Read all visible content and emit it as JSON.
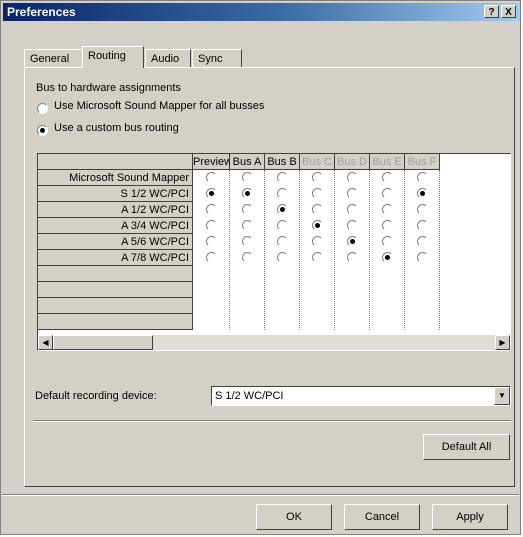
{
  "window": {
    "title": "Preferences",
    "help_btn": "?",
    "close_btn": "X"
  },
  "tabs": [
    {
      "label": "General"
    },
    {
      "label": "Routing"
    },
    {
      "label": "Audio"
    },
    {
      "label": "Sync"
    }
  ],
  "routing": {
    "group_label": "Bus to hardware assignments",
    "option_mapper": "Use Microsoft Sound Mapper for all busses",
    "option_custom": "Use a custom bus routing",
    "selected_option": "custom",
    "columns": [
      "Preview",
      "Bus A",
      "Bus B",
      "Bus C",
      "Bus D",
      "Bus E",
      "Bus F"
    ],
    "disabled_columns": [
      "Bus C",
      "Bus D",
      "Bus E",
      "Bus F"
    ],
    "rows": [
      {
        "label": "Microsoft Sound Mapper",
        "selected_col": -1
      },
      {
        "label": "S 1/2 WC/PCI",
        "selected_col": 0
      },
      {
        "label": "A 1/2 WC/PCI",
        "selected_col": 2
      },
      {
        "label": "A 3/4 WC/PCI",
        "selected_col": 3
      },
      {
        "label": "A 5/6 WC/PCI",
        "selected_col": 4
      },
      {
        "label": "A 7/8 WC/PCI",
        "selected_col": 5
      }
    ],
    "bus_a_row": 1,
    "bus_f_row": 1
  },
  "recording": {
    "label": "Default recording device:",
    "value": "S 1/2 WC/PCI"
  },
  "buttons": {
    "default_all": "Default All",
    "ok": "OK",
    "cancel": "Cancel",
    "apply": "Apply"
  },
  "icons": {
    "scroll_left": "left-arrow-icon",
    "scroll_right": "right-arrow-icon",
    "dropdown": "chevron-down-icon"
  }
}
